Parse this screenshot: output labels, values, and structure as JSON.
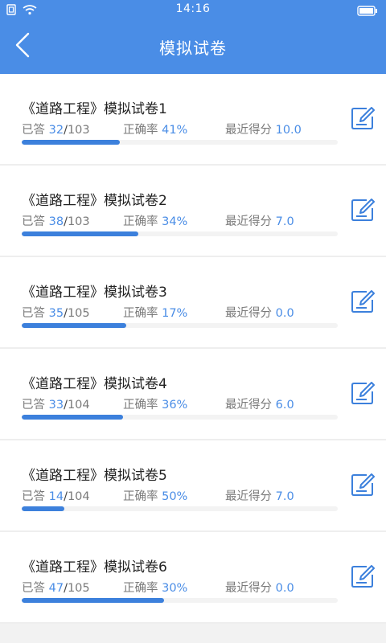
{
  "status_bar": {
    "time": "14:16",
    "icons": [
      "sim-icon",
      "wifi-icon",
      "battery-icon"
    ]
  },
  "header": {
    "title": "模拟试卷",
    "back_icon": "chevron-left-icon"
  },
  "labels": {
    "answered": "已答",
    "correct_rate": "正确率",
    "recent_score": "最近得分",
    "slash": "/"
  },
  "colors": {
    "header_bg": "#4a8de6",
    "accent": "#4a8de6",
    "progress_fill": "#3c80dc"
  },
  "papers": [
    {
      "title": "《道路工程》模拟试卷1",
      "answered": "32",
      "total": "103",
      "rate": "41%",
      "score": "10.0",
      "progress": 0.31
    },
    {
      "title": "《道路工程》模拟试卷2",
      "answered": "38",
      "total": "103",
      "rate": "34%",
      "score": "7.0",
      "progress": 0.37
    },
    {
      "title": "《道路工程》模拟试卷3",
      "answered": "35",
      "total": "105",
      "rate": "17%",
      "score": "0.0",
      "progress": 0.33
    },
    {
      "title": "《道路工程》模拟试卷4",
      "answered": "33",
      "total": "104",
      "rate": "36%",
      "score": "6.0",
      "progress": 0.32
    },
    {
      "title": "《道路工程》模拟试卷5",
      "answered": "14",
      "total": "104",
      "rate": "50%",
      "score": "7.0",
      "progress": 0.135
    },
    {
      "title": "《道路工程》模拟试卷6",
      "answered": "47",
      "total": "105",
      "rate": "30%",
      "score": "0.0",
      "progress": 0.45
    }
  ]
}
